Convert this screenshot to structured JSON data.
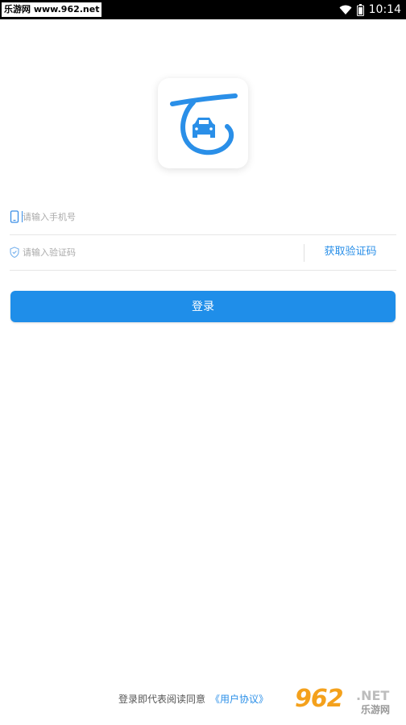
{
  "status_bar": {
    "watermark": "乐游网 www.962.net",
    "time": "10:14"
  },
  "logo": {
    "icon": "car-logo-icon",
    "color": "#2a8fe8"
  },
  "phone_field": {
    "placeholder": "请输入手机号",
    "value": "",
    "icon": "phone-icon"
  },
  "code_field": {
    "placeholder": "请输入验证码",
    "value": "",
    "icon": "shield-icon",
    "get_code_label": "获取验证码"
  },
  "login_button": {
    "label": "登录",
    "color": "#1f8ee9"
  },
  "footer": {
    "agree_text": "登录即代表阅读同意",
    "agreement_link": "《用户协议》"
  },
  "watermark_br": {
    "big": "962",
    "net": ".NET",
    "sub": "乐游网"
  }
}
